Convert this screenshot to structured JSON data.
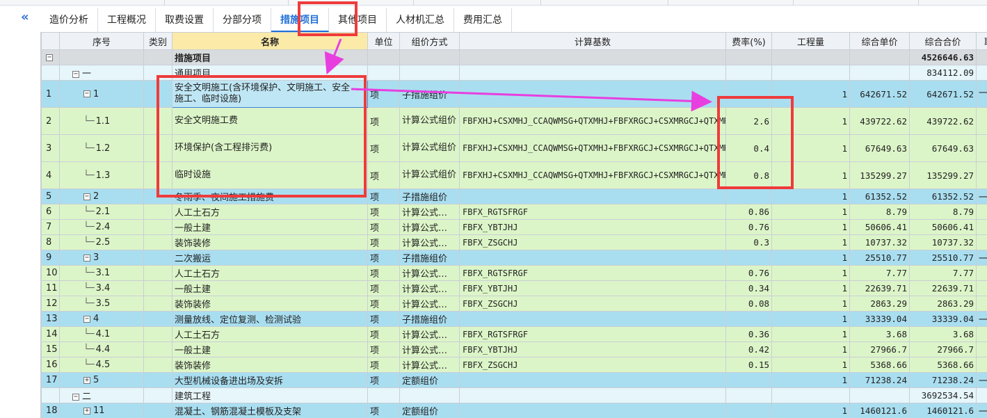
{
  "nav": {
    "collapse_glyph": "«"
  },
  "tabs": [
    {
      "label": "造价分析",
      "active": false
    },
    {
      "label": "工程概况",
      "active": false
    },
    {
      "label": "取费设置",
      "active": false
    },
    {
      "label": "分部分项",
      "active": false
    },
    {
      "label": "措施项目",
      "active": true
    },
    {
      "label": "其他项目",
      "active": false
    },
    {
      "label": "人材机汇总",
      "active": false
    },
    {
      "label": "费用汇总",
      "active": false
    }
  ],
  "columns": [
    "",
    "序号",
    "类别",
    "名称",
    "单位",
    "组价方式",
    "计算基数",
    "费率(%)",
    "工程量",
    "综合单价",
    "综合合价",
    "取"
  ],
  "rows": [
    {
      "idx": "",
      "seq": "",
      "cat": "",
      "name": "措施项目",
      "unit": "",
      "method": "",
      "base": "",
      "rate": "",
      "qty": "",
      "price": "",
      "total": "4526646.63",
      "extra": "",
      "type": "top"
    },
    {
      "idx": "",
      "seq": "一",
      "cat": "",
      "name": "通用项目",
      "unit": "",
      "method": "",
      "base": "",
      "rate": "",
      "qty": "",
      "price": "",
      "total": "834112.09",
      "extra": "",
      "type": "sec"
    },
    {
      "idx": "1",
      "seq": "1",
      "cat": "",
      "name": "安全文明施工(含环境保护、文明施工、安全施工、临时设施)",
      "unit": "项",
      "method": "子措施组价",
      "base": "",
      "rate": "",
      "qty": "1",
      "price": "642671.52",
      "total": "642671.52",
      "extra": "一程",
      "type": "sub"
    },
    {
      "idx": "2",
      "seq": "1.1",
      "cat": "",
      "name": "安全文明施工费",
      "unit": "项",
      "method": "计算公式组价",
      "base": "FBFXHJ+CSXMHJ_CCAQWMSG+QTXMHJ+FBFXRGCJ+CSXMRGCJ+QTXMRGCJ",
      "rate": "2.6",
      "qty": "1",
      "price": "439722.62",
      "total": "439722.62",
      "extra": "",
      "type": "leaf"
    },
    {
      "idx": "3",
      "seq": "1.2",
      "cat": "",
      "name": "环境保护(含工程排污费)",
      "unit": "项",
      "method": "计算公式组价",
      "base": "FBFXHJ+CSXMHJ_CCAQWMSG+QTXMHJ+FBFXRGCJ+CSXMRGCJ+QTXMRGCJ",
      "rate": "0.4",
      "qty": "1",
      "price": "67649.63",
      "total": "67649.63",
      "extra": "",
      "type": "leaf"
    },
    {
      "idx": "4",
      "seq": "1.3",
      "cat": "",
      "name": "临时设施",
      "unit": "项",
      "method": "计算公式组价",
      "base": "FBFXHJ+CSXMHJ_CCAQWMSG+QTXMHJ+FBFXRGCJ+CSXMRGCJ+QTXMRGCJ",
      "rate": "0.8",
      "qty": "1",
      "price": "135299.27",
      "total": "135299.27",
      "extra": "",
      "type": "leaf"
    },
    {
      "idx": "5",
      "seq": "2",
      "cat": "",
      "name": "冬雨季、夜间施工措施费",
      "unit": "项",
      "method": "子措施组价",
      "base": "",
      "rate": "",
      "qty": "1",
      "price": "61352.52",
      "total": "61352.52",
      "extra": "一",
      "type": "sub"
    },
    {
      "idx": "6",
      "seq": "2.1",
      "cat": "",
      "name": "人工土石方",
      "unit": "项",
      "method": "计算公式…",
      "base": "FBFX_RGTSFRGF",
      "rate": "0.86",
      "qty": "1",
      "price": "8.79",
      "total": "8.79",
      "extra": "",
      "type": "leaf"
    },
    {
      "idx": "7",
      "seq": "2.4",
      "cat": "",
      "name": "一般土建",
      "unit": "项",
      "method": "计算公式…",
      "base": "FBFX_YBTJHJ",
      "rate": "0.76",
      "qty": "1",
      "price": "50606.41",
      "total": "50606.41",
      "extra": "",
      "type": "leaf"
    },
    {
      "idx": "8",
      "seq": "2.5",
      "cat": "",
      "name": "装饰装修",
      "unit": "项",
      "method": "计算公式…",
      "base": "FBFX_ZSGCHJ",
      "rate": "0.3",
      "qty": "1",
      "price": "10737.32",
      "total": "10737.32",
      "extra": "",
      "type": "leaf"
    },
    {
      "idx": "9",
      "seq": "3",
      "cat": "",
      "name": "二次搬运",
      "unit": "项",
      "method": "子措施组价",
      "base": "",
      "rate": "",
      "qty": "1",
      "price": "25510.77",
      "total": "25510.77",
      "extra": "一",
      "type": "sub"
    },
    {
      "idx": "10",
      "seq": "3.1",
      "cat": "",
      "name": "人工土石方",
      "unit": "项",
      "method": "计算公式…",
      "base": "FBFX_RGTSFRGF",
      "rate": "0.76",
      "qty": "1",
      "price": "7.77",
      "total": "7.77",
      "extra": "",
      "type": "leaf"
    },
    {
      "idx": "11",
      "seq": "3.4",
      "cat": "",
      "name": "一般土建",
      "unit": "项",
      "method": "计算公式…",
      "base": "FBFX_YBTJHJ",
      "rate": "0.34",
      "qty": "1",
      "price": "22639.71",
      "total": "22639.71",
      "extra": "",
      "type": "leaf"
    },
    {
      "idx": "12",
      "seq": "3.5",
      "cat": "",
      "name": "装饰装修",
      "unit": "项",
      "method": "计算公式…",
      "base": "FBFX_ZSGCHJ",
      "rate": "0.08",
      "qty": "1",
      "price": "2863.29",
      "total": "2863.29",
      "extra": "",
      "type": "leaf"
    },
    {
      "idx": "13",
      "seq": "4",
      "cat": "",
      "name": "测量放线、定位复测、检测试验",
      "unit": "项",
      "method": "子措施组价",
      "base": "",
      "rate": "",
      "qty": "1",
      "price": "33339.04",
      "total": "33339.04",
      "extra": "一",
      "type": "sub"
    },
    {
      "idx": "14",
      "seq": "4.1",
      "cat": "",
      "name": "人工土石方",
      "unit": "项",
      "method": "计算公式…",
      "base": "FBFX_RGTSFRGF",
      "rate": "0.36",
      "qty": "1",
      "price": "3.68",
      "total": "3.68",
      "extra": "",
      "type": "leaf"
    },
    {
      "idx": "15",
      "seq": "4.4",
      "cat": "",
      "name": "一般土建",
      "unit": "项",
      "method": "计算公式…",
      "base": "FBFX_YBTJHJ",
      "rate": "0.42",
      "qty": "1",
      "price": "27966.7",
      "total": "27966.7",
      "extra": "",
      "type": "leaf"
    },
    {
      "idx": "16",
      "seq": "4.5",
      "cat": "",
      "name": "装饰装修",
      "unit": "项",
      "method": "计算公式…",
      "base": "FBFX_ZSGCHJ",
      "rate": "0.15",
      "qty": "1",
      "price": "5368.66",
      "total": "5368.66",
      "extra": "",
      "type": "leaf"
    },
    {
      "idx": "17",
      "seq": "5",
      "cat": "",
      "name": "大型机械设备进出场及安拆",
      "unit": "项",
      "method": "定额组价",
      "base": "",
      "rate": "",
      "qty": "1",
      "price": "71238.24",
      "total": "71238.24",
      "extra": "一",
      "type": "sub"
    },
    {
      "idx": "",
      "seq": "二",
      "cat": "",
      "name": "建筑工程",
      "unit": "",
      "method": "",
      "base": "",
      "rate": "",
      "qty": "",
      "price": "",
      "total": "3692534.54",
      "extra": "",
      "type": "sec"
    },
    {
      "idx": "18",
      "seq": "11",
      "cat": "",
      "name": "混凝土、钢筋混凝土模板及支架",
      "unit": "项",
      "method": "定额组价",
      "base": "",
      "rate": "",
      "qty": "1",
      "price": "1460121.6",
      "total": "1460121.6",
      "extra": "一",
      "type": "sub"
    }
  ],
  "colors": {
    "annotation": "#ef3b3b",
    "arrow": "#e83ee0",
    "accent": "#1e6fd8"
  }
}
